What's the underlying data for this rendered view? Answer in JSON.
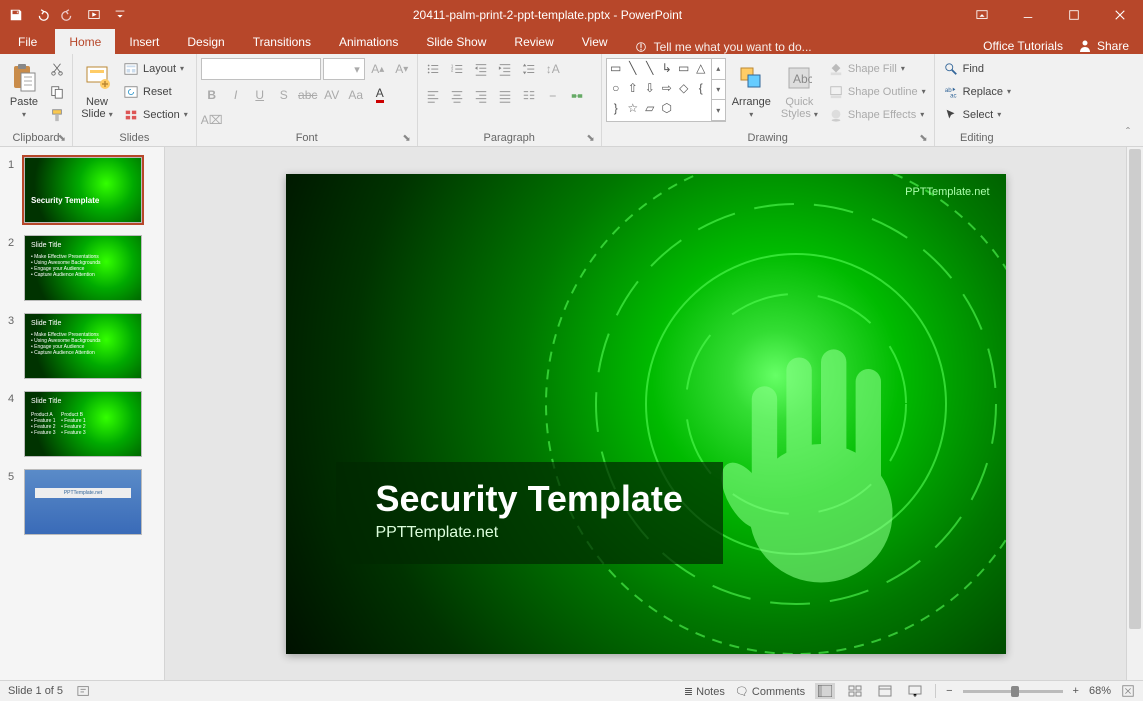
{
  "app": {
    "name": "PowerPoint",
    "filename": "20411-palm-print-2-ppt-template.pptx"
  },
  "tabs": {
    "file": "File",
    "home": "Home",
    "insert": "Insert",
    "design": "Design",
    "transitions": "Transitions",
    "animations": "Animations",
    "slideshow": "Slide Show",
    "review": "Review",
    "view": "View",
    "tellme": "Tell me what you want to do...",
    "tutorials": "Office Tutorials",
    "share": "Share"
  },
  "ribbon": {
    "clipboard": {
      "label": "Clipboard",
      "paste": "Paste",
      "cut": "Cut",
      "copy": "Copy",
      "painter": "Format Painter"
    },
    "slides": {
      "label": "Slides",
      "new": "New\nSlide",
      "layout": "Layout",
      "reset": "Reset",
      "section": "Section"
    },
    "font": {
      "label": "Font"
    },
    "paragraph": {
      "label": "Paragraph"
    },
    "drawing": {
      "label": "Drawing",
      "arrange": "Arrange",
      "quick": "Quick\nStyles",
      "fill": "Shape Fill",
      "outline": "Shape Outline",
      "effects": "Shape Effects"
    },
    "editing": {
      "label": "Editing",
      "find": "Find",
      "replace": "Replace",
      "select": "Select"
    }
  },
  "slide": {
    "title": "Security Template",
    "subtitle": "PPTTemplate.net",
    "watermark": "PPTTemplate.net"
  },
  "thumbs": [
    {
      "n": "1",
      "title": "Security Template"
    },
    {
      "n": "2",
      "title": "Slide Title"
    },
    {
      "n": "3",
      "title": "Slide Title"
    },
    {
      "n": "4",
      "title": "Slide Title"
    },
    {
      "n": "5",
      "title": "PPTTemplate.net"
    }
  ],
  "status": {
    "slide": "Slide 1 of 5",
    "notes": "Notes",
    "comments": "Comments",
    "zoom": "68%"
  }
}
